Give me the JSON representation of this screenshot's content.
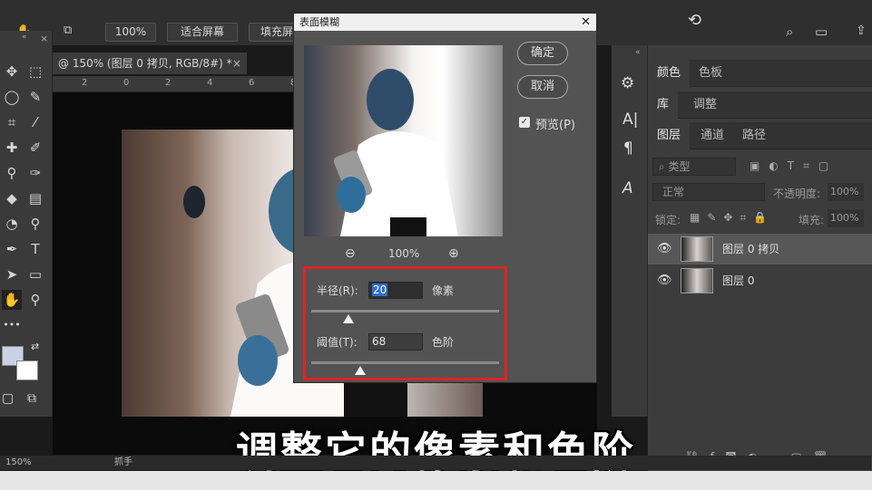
{
  "optbar": {
    "zoom_value": "100%",
    "fit_screen": "适合屏幕",
    "fill_screen": "填充屏"
  },
  "document": {
    "tab_title": "@ 150% (图层 0 拷贝, RGB/8#) *",
    "ruler_labels": [
      "2",
      "0",
      "2",
      "4",
      "6",
      "8"
    ]
  },
  "dialog": {
    "title": "表面模糊",
    "ok": "确定",
    "cancel": "取消",
    "preview_label": "预览(P)",
    "preview_checked": true,
    "zoom": "100%",
    "radius_label": "半径(R):",
    "radius_value": "20",
    "radius_unit": "像素",
    "radius_fraction": 0.2,
    "threshold_label": "阈值(T):",
    "threshold_value": "68",
    "threshold_unit": "色阶",
    "threshold_fraction": 0.26
  },
  "panels": {
    "tabs_color": [
      "颜色",
      "色板"
    ],
    "tabs_lib": [
      "库",
      "调整"
    ],
    "tabs_layers": [
      "图层",
      "通道",
      "路径"
    ],
    "filter_placeholder": "类型",
    "blend_mode": "正常",
    "opacity_label": "不透明度:",
    "opacity_value": "100%",
    "lock_label": "锁定:",
    "fill_label": "填充:",
    "fill_value": "100%",
    "layers": [
      {
        "name": "图层 0 拷贝",
        "selected": true
      },
      {
        "name": "图层 0",
        "selected": false
      }
    ]
  },
  "subtitle": "调整它的像素和色阶",
  "status": {
    "zoom": "150%",
    "tool": "抓手"
  },
  "colors": {
    "highlight_box": "#e02323",
    "foreground_swatch": "#c9d2e6",
    "background_swatch": "#ffffff"
  }
}
